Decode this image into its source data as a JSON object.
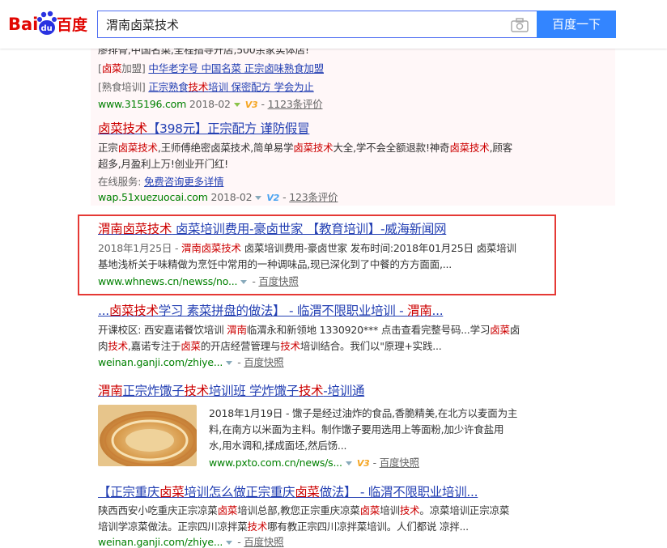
{
  "search": {
    "query": "渭南卤菜技术",
    "button_label": "百度一下"
  },
  "logo": {
    "text_bai": "Bai",
    "text_du": "du",
    "text_cn": "百度"
  },
  "ad1": {
    "line_top": "廖排骨,中国名菜,全程指导开店,500余家实体店!",
    "sub1_prefix": "[",
    "sub1_kw": "卤菜",
    "sub1_rest": "加盟]",
    "sub1_link": "中华老字号 中国名菜 正宗卤味熟食加盟",
    "sub2_prefix": "[熟食培训]",
    "sub2_link_a": "正宗熟食",
    "sub2_link_kw": "技术",
    "sub2_link_b": "培训 保密配方 学会为止",
    "url": "www.315196.com",
    "date": "2018-02",
    "vlabel": "V3",
    "reviews": "1123条评价"
  },
  "ad2": {
    "title_kw": "卤菜技术",
    "title_rest": "【398元】正宗配方  谨防假冒",
    "abs1_a": "正宗",
    "abs1_kw1": "卤菜技术",
    "abs1_b": ",王师傅绝密卤菜技术,简单易学",
    "abs1_kw2": "卤菜技术",
    "abs1_c": "大全,学不会全额退款!神奇",
    "abs1_kw3": "卤菜技术",
    "abs1_d": ",顾客",
    "abs2": "超多,月盈利上万!创业开门红!",
    "service_label": "在线服务:",
    "service_link": "免费咨询更多详情",
    "url": "wap.51xuezuocai.com",
    "date": "2018-02",
    "vlabel": "V2",
    "reviews": "123条评价"
  },
  "r1": {
    "title_kw": "渭南卤菜技术",
    "title_rest": " 卤菜培训费用-豪卤世家 【教育培训】-威海新闻网",
    "date": "2018年1月25日 - ",
    "abs1_kw": "渭南卤菜技术",
    "abs1_rest": " 卤菜培训费用-豪卤世家 发布时间:2018年01月25日 卤菜培训",
    "abs2": "基地浅析关于味精做为烹饪中常用的一种调味品,现已深化到了中餐的方方面面,...",
    "url": "www.whnews.cn/newss/no...",
    "snapshot": "百度快照"
  },
  "r2": {
    "title_a": "...",
    "title_kw": "卤菜技术",
    "title_b": "学习 素菜拼盘的做法】 - 临渭不限职业培训 - ",
    "title_kw2": "渭南",
    "title_c": "...",
    "abs1_a": "开课校区: 西安嘉诺餐饮培训 ",
    "abs1_kw": "渭南",
    "abs1_b": "临渭永和新领地 1330920*** 点击查看完整号码...学习",
    "abs1_kw2": "卤菜",
    "abs1_c": "卤",
    "abs2_a": "肉",
    "abs2_kw": "技术",
    "abs2_b": ",嘉诺专注于",
    "abs2_kw2": "卤菜",
    "abs2_c": "的开店经营管理与",
    "abs2_kw3": "技术",
    "abs2_d": "培训结合。我们以\"原理+实践...",
    "url": "weinan.ganji.com/zhiye...",
    "snapshot": "百度快照"
  },
  "r3": {
    "title_kw": "渭南",
    "title_a": "正宗炸馓子",
    "title_kw2": "技术",
    "title_b": "培训班 学炸馓子",
    "title_kw3": "技术",
    "title_c": "-培训通",
    "abs1": "2018年1月19日 - 馓子是经过油炸的食品,香脆精美,在北方以麦面为主",
    "abs2": "料,在南方以米面为主料。制作馓子要用选用上等面粉,加少许食盐用",
    "abs3": "水,用水调和,揉成面坯,然后饧...",
    "url": "www.pxto.com.cn/news/s...",
    "vlabel": "V3",
    "snapshot": "百度快照"
  },
  "r4": {
    "title_a": "【正宗重庆",
    "title_kw": "卤菜",
    "title_b": "培训怎么做正宗重庆",
    "title_kw2": "卤菜",
    "title_c": "做法】 - 临渭不限职业培训...",
    "abs1_a": "陕西西安小吃重庆正宗凉菜",
    "abs1_kw": "卤菜",
    "abs1_b": "培训总部,教您正宗重庆凉菜",
    "abs1_kw2": "卤菜",
    "abs1_c": "培训",
    "abs1_kw3": "技术",
    "abs1_d": "。凉菜培训正宗凉菜",
    "abs2_a": "培训学凉菜做法。正宗四川凉拌菜",
    "abs2_kw": "技术",
    "abs2_b": "哪有教正宗四川凉拌菜培训。人们都说 凉拌...",
    "url": "weinan.ganji.com/zhiye...",
    "snapshot": "百度快照"
  }
}
